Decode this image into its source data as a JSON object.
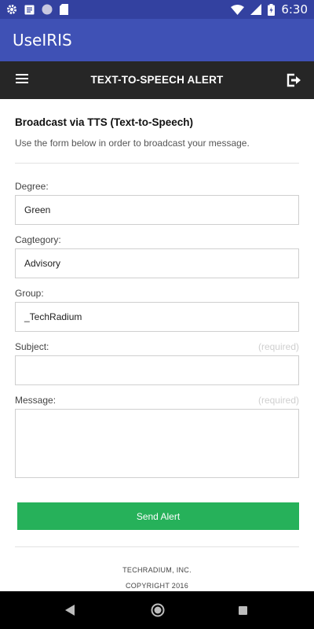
{
  "status_bar": {
    "time": "6:30",
    "icons_left": [
      "gear-icon",
      "message-icon",
      "circle-icon",
      "sd-card-icon"
    ],
    "icons_right": [
      "wifi-icon",
      "signal-icon",
      "battery-charging-icon"
    ]
  },
  "app_bar": {
    "title": "UseIRIS"
  },
  "header": {
    "title": "TEXT-TO-SPEECH ALERT",
    "left_icon": "menu-icon",
    "right_icon": "logout-icon"
  },
  "form": {
    "title": "Broadcast via TTS (Text-to-Speech)",
    "description": "Use the form below in order to broadcast your message.",
    "degree": {
      "label": "Degree:",
      "value": "Green"
    },
    "category": {
      "label": "Cagtegory:",
      "value": "Advisory"
    },
    "group": {
      "label": "Group:",
      "value": "_TechRadium"
    },
    "subject": {
      "label": "Subject:",
      "value": "",
      "hint": "(required)"
    },
    "message": {
      "label": "Message:",
      "value": "",
      "hint": "(required)"
    },
    "send_label": "Send Alert"
  },
  "footer": {
    "company": "TECHRADIUM, INC.",
    "copyright": "COPYRIGHT 2016"
  },
  "colors": {
    "status_bar": "#3341a0",
    "app_bar": "#3f51b5",
    "header": "#262626",
    "send_button": "#26b15a"
  }
}
